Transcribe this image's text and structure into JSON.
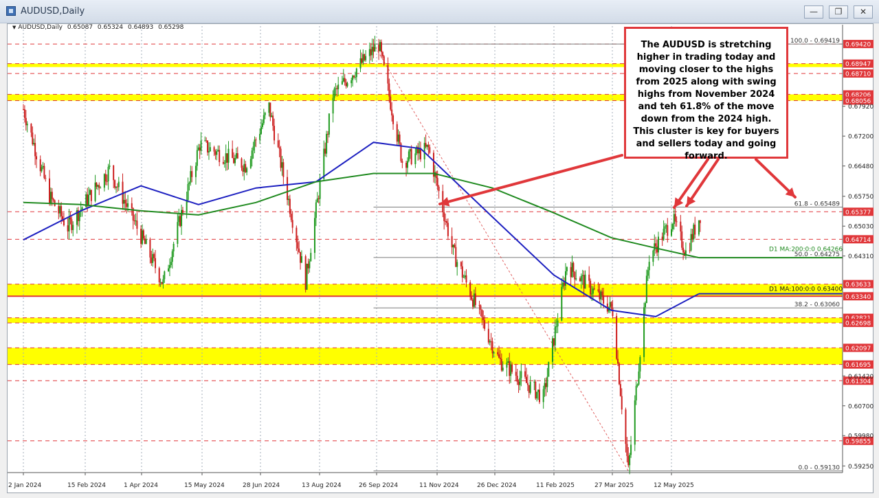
{
  "window": {
    "title": "AUDUSD,Daily",
    "minimize_label": "—",
    "restore_label": "❐",
    "close_label": "✕"
  },
  "header": {
    "symbol": "AUDUSD,Daily",
    "open": "0.65087",
    "high": "0.65324",
    "low": "0.64893",
    "close": "0.65298"
  },
  "annotation": {
    "text": "The AUDUSD is stretching higher in trading today and moving closer to the highs from 2025 along with swing highs from November 2024 and teh 61.8% of the move down from the 2024 high.  This cluster is key for buyers and sellers today and going forward."
  },
  "colors": {
    "ma100": "#1c1fc0",
    "ma200": "#1f8a1f",
    "zone": "#ffff00",
    "level_red": "#e0373a",
    "bull_candle": "#1f9a1f",
    "bear_candle": "#cc1d1d",
    "grid": "#a3adb8",
    "price_label_bg": "#e0373a"
  },
  "chart_data": {
    "type": "candlestick",
    "title": "AUDUSD,Daily",
    "ylim": [
      0.5909,
      0.6962
    ],
    "x_ticks": [
      "2 Jan 2024",
      "15 Feb 2024",
      "1 Apr 2024",
      "15 May 2024",
      "28 Jun 2024",
      "13 Aug 2024",
      "26 Sep 2024",
      "11 Nov 2024",
      "26 Dec 2024",
      "11 Feb 2025",
      "27 Mar 2025",
      "12 May 2025"
    ],
    "y_ticks": [
      "0.66480",
      "0.65750",
      "0.65030",
      "0.64310",
      "0.61420",
      "0.60700",
      "0.59980",
      "0.59250",
      "0.67200",
      "0.67920"
    ],
    "price_path": [
      {
        "date": "2 Jan 2024",
        "price": 0.6785
      },
      {
        "date": "22 Jan 2024",
        "price": 0.6575
      },
      {
        "date": "5 Feb 2024",
        "price": 0.65
      },
      {
        "date": "25 Feb 2024",
        "price": 0.659
      },
      {
        "date": "8 Mar 2024",
        "price": 0.664
      },
      {
        "date": "18 Apr 2024",
        "price": 0.6365
      },
      {
        "date": "16 May 2024",
        "price": 0.67
      },
      {
        "date": "20 Jun 2024",
        "price": 0.665
      },
      {
        "date": "8 Jul 2024",
        "price": 0.679
      },
      {
        "date": "5 Aug 2024",
        "price": 0.637
      },
      {
        "date": "26 Aug 2024",
        "price": 0.682
      },
      {
        "date": "30 Sep 2024",
        "price": 0.6942
      },
      {
        "date": "18 Oct 2024",
        "price": 0.666
      },
      {
        "date": "7 Nov 2024",
        "price": 0.669
      },
      {
        "date": "26 Nov 2024",
        "price": 0.644
      },
      {
        "date": "31 Dec 2024",
        "price": 0.618
      },
      {
        "date": "3 Feb 2025",
        "price": 0.609
      },
      {
        "date": "21 Feb 2025",
        "price": 0.641
      },
      {
        "date": "28 Mar 2025",
        "price": 0.63
      },
      {
        "date": "9 Apr 2025",
        "price": 0.5913
      },
      {
        "date": "25 Apr 2025",
        "price": 0.643
      },
      {
        "date": "13 May 2025",
        "price": 0.652
      },
      {
        "date": "23 May 2025",
        "price": 0.644
      },
      {
        "date": "3 Jun 2025",
        "price": 0.653
      }
    ],
    "ma100": {
      "name": "D1 MA:100:0:0",
      "value": "0.63400",
      "path": [
        {
          "date": "2 Jan 2024",
          "price": 0.647
        },
        {
          "date": "15 Feb 2024",
          "price": 0.654
        },
        {
          "date": "1 Apr 2024",
          "price": 0.66
        },
        {
          "date": "15 May 2024",
          "price": 0.6555
        },
        {
          "date": "28 Jun 2024",
          "price": 0.6595
        },
        {
          "date": "13 Aug 2024",
          "price": 0.661
        },
        {
          "date": "26 Sep 2024",
          "price": 0.6705
        },
        {
          "date": "1 Nov 2024",
          "price": 0.669
        },
        {
          "date": "26 Dec 2024",
          "price": 0.6525
        },
        {
          "date": "11 Feb 2025",
          "price": 0.6385
        },
        {
          "date": "27 Mar 2025",
          "price": 0.63
        },
        {
          "date": "30 Apr 2025",
          "price": 0.6285
        },
        {
          "date": "2 Jun 2025",
          "price": 0.634
        }
      ]
    },
    "ma200": {
      "name": "D1 MA:200:0:0",
      "value": "0.64266",
      "path": [
        {
          "date": "2 Jan 2024",
          "price": 0.656
        },
        {
          "date": "15 Feb 2024",
          "price": 0.6555
        },
        {
          "date": "1 Apr 2024",
          "price": 0.654
        },
        {
          "date": "15 May 2024",
          "price": 0.653
        },
        {
          "date": "28 Jun 2024",
          "price": 0.656
        },
        {
          "date": "13 Aug 2024",
          "price": 0.661
        },
        {
          "date": "26 Sep 2024",
          "price": 0.663
        },
        {
          "date": "11 Nov 2024",
          "price": 0.663
        },
        {
          "date": "26 Dec 2024",
          "price": 0.6595
        },
        {
          "date": "11 Feb 2025",
          "price": 0.6535
        },
        {
          "date": "27 Mar 2025",
          "price": 0.6475
        },
        {
          "date": "30 Apr 2025",
          "price": 0.645
        },
        {
          "date": "2 Jun 2025",
          "price": 0.6427
        }
      ]
    },
    "fibonacci": [
      {
        "label": "100.0 - 0.69419",
        "price": 0.69419
      },
      {
        "label": "61.8 - 0.65489",
        "price": 0.65489
      },
      {
        "label": "50.0 - 0.64275",
        "price": 0.64275
      },
      {
        "label": "38.2 - 0.63060",
        "price": 0.6306
      },
      {
        "label": "0.0 - 0.59130",
        "price": 0.5913
      }
    ],
    "zones": [
      {
        "from": 0.6888,
        "to": 0.68947
      },
      {
        "from": 0.68056,
        "to": 0.68206
      },
      {
        "from": 0.6334,
        "to": 0.63633
      },
      {
        "from": 0.62698,
        "to": 0.62821
      },
      {
        "from": 0.61695,
        "to": 0.62097
      }
    ],
    "levels": [
      {
        "label": "0.69420",
        "price": 0.6942
      },
      {
        "label": "0.68947",
        "price": 0.68947
      },
      {
        "label": "0.68710",
        "price": 0.6871
      },
      {
        "label": "0.68206",
        "price": 0.68206
      },
      {
        "label": "0.68056",
        "price": 0.68056
      },
      {
        "label": "0.65377",
        "price": 0.65377
      },
      {
        "label": "0.64714",
        "price": 0.64714
      },
      {
        "label": "0.63633",
        "price": 0.63633
      },
      {
        "label": "0.63340",
        "price": 0.6334
      },
      {
        "label": "0.62821",
        "price": 0.62821
      },
      {
        "label": "0.62698",
        "price": 0.62698
      },
      {
        "label": "0.62097",
        "price": 0.62097
      },
      {
        "label": "0.61695",
        "price": 0.61695
      },
      {
        "label": "0.61304",
        "price": 0.61304
      },
      {
        "label": "0.59855",
        "price": 0.59855
      }
    ]
  }
}
